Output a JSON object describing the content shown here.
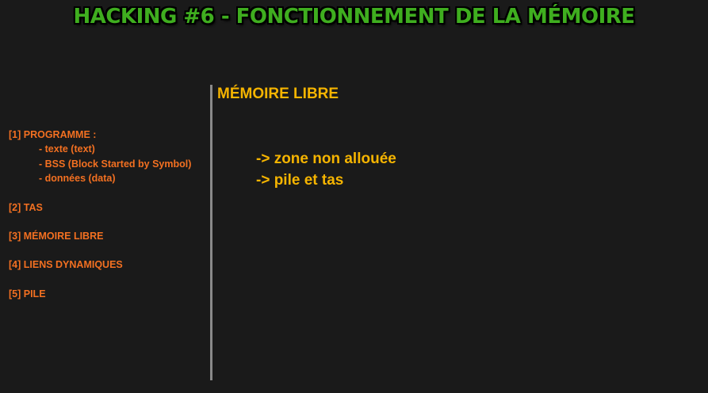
{
  "title": "HACKING #6 - FONCTIONNEMENT DE LA MÉMOIRE",
  "toc": {
    "programme": "[1] PROGRAMME :",
    "sub_text": "- texte (text)",
    "sub_bss": "- BSS (Block Started by Symbol)",
    "sub_data": "- données (data)",
    "tas": "[2] TAS",
    "memoire_libre": "[3] MÉMOIRE LIBRE",
    "liens": "[4] LIENS DYNAMIQUES",
    "pile": "[5] PILE"
  },
  "section": {
    "title": "MÉMOIRE LIBRE",
    "bullets": [
      "-> zone non allouée",
      "-> pile et tas"
    ]
  },
  "colors": {
    "title": "#3fae1f",
    "toc": "#f37021",
    "section": "#f5b400",
    "background": "#1a1a1a",
    "divider": "#8a8a8a"
  }
}
